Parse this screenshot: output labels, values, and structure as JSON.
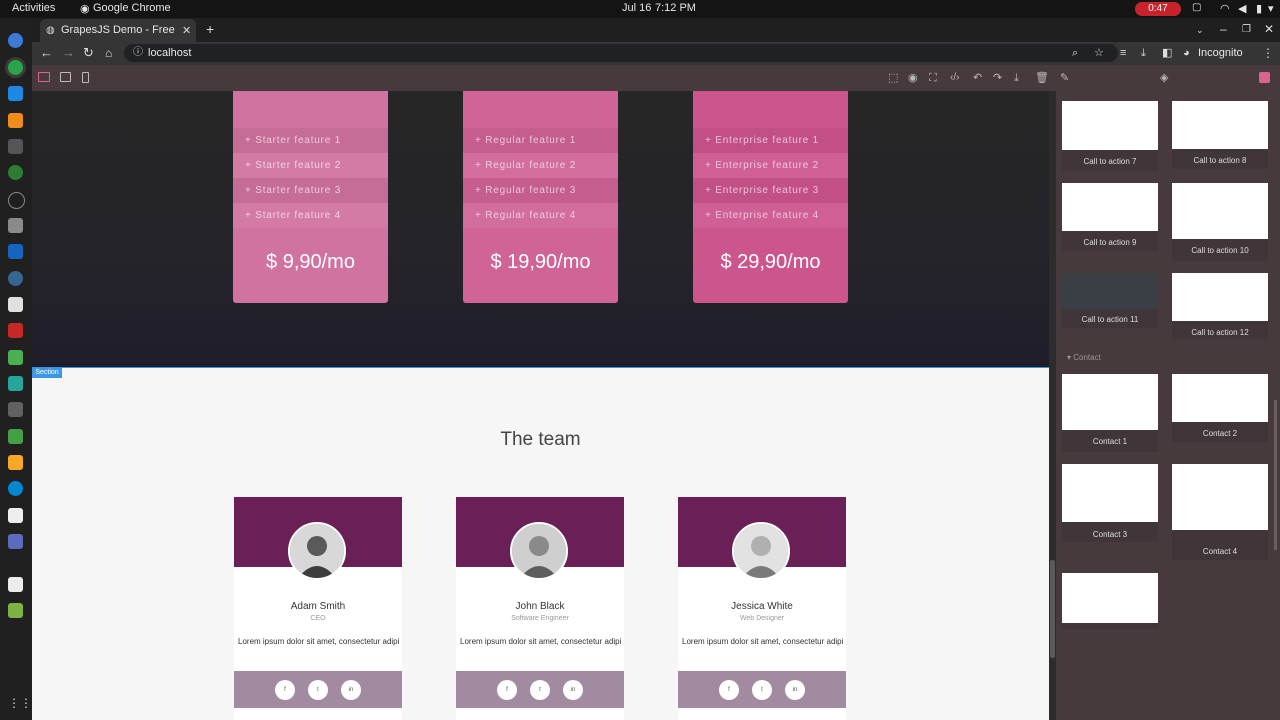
{
  "os": {
    "activities": "Activities",
    "app_name": "Google Chrome",
    "date": "Jul 16",
    "time": "7:12 PM",
    "recording_time": "0:47"
  },
  "browser": {
    "tab_title": "GrapesJS Demo - Free Op",
    "address": "localhost",
    "profile": "Incognito"
  },
  "canvas": {
    "pricing": [
      {
        "features": [
          "+ Starter feature 1",
          "+ Starter feature 2",
          "+ Starter feature 3",
          "+ Starter feature 4"
        ],
        "price": "$ 9,90/mo",
        "color": "#d173a0"
      },
      {
        "features": [
          "+ Regular feature 1",
          "+ Regular feature 2",
          "+ Regular feature 3",
          "+ Regular feature 4"
        ],
        "price": "$ 19,90/mo",
        "color": "#d06497"
      },
      {
        "features": [
          "+ Enterprise feature 1",
          "+ Enterprise feature 2",
          "+ Enterprise feature 3",
          "+ Enterprise feature 4"
        ],
        "price": "$ 29,90/mo",
        "color": "#cd558e"
      }
    ],
    "section_badge": "Section",
    "team_title": "The team",
    "team": [
      {
        "name": "Adam Smith",
        "role": "CEO",
        "desc": "Lorem ipsum dolor sit amet, consectetur adipi"
      },
      {
        "name": "John Black",
        "role": "Software Engineer",
        "desc": "Lorem ipsum dolor sit amet, consectetur adipi"
      },
      {
        "name": "Jessica White",
        "role": "Web Designer",
        "desc": "Lorem ipsum dolor sit amet, consectetur adipi"
      }
    ],
    "social": [
      "f",
      "t",
      "in"
    ]
  },
  "blocks": {
    "category_contact": "Contact",
    "items": [
      {
        "label": "Call to action 7"
      },
      {
        "label": "Call to action 8"
      },
      {
        "label": "Call to action 9"
      },
      {
        "label": "Call to action 10"
      },
      {
        "label": "Call to action 11"
      },
      {
        "label": "Call to action 12"
      },
      {
        "label": "Contact 1"
      },
      {
        "label": "Contact 2"
      },
      {
        "label": "Contact 3"
      },
      {
        "label": "Contact 4"
      },
      {
        "label": ""
      }
    ]
  },
  "colors": {
    "accent": "#3b97e3",
    "panel": "#463a3c",
    "team_header": "#6a1f57",
    "team_footer": "#a28ba1",
    "recording": "#c8232b"
  }
}
